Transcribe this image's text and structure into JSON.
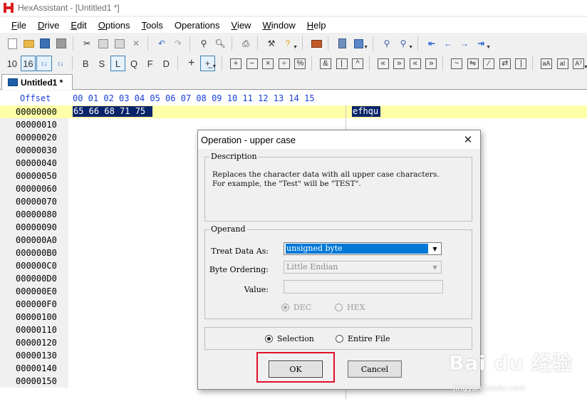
{
  "window": {
    "title": "HexAssistant - [Untitled1 *]"
  },
  "menu": [
    {
      "label": "File",
      "mnemonic": "F",
      "rest": "ile"
    },
    {
      "label": "Drive",
      "mnemonic": "D",
      "rest": "rive"
    },
    {
      "label": "Edit",
      "mnemonic": "E",
      "rest": "dit"
    },
    {
      "label": "Options",
      "mnemonic": "O",
      "rest": "ptions"
    },
    {
      "label": "Tools",
      "mnemonic": "T",
      "rest": "ools"
    },
    {
      "label": "Operations",
      "mnemonic": "",
      "rest": "Operations"
    },
    {
      "label": "View",
      "mnemonic": "V",
      "rest": "iew"
    },
    {
      "label": "Window",
      "mnemonic": "W",
      "rest": "indow"
    },
    {
      "label": "Help",
      "mnemonic": "H",
      "rest": "elp"
    }
  ],
  "toolbar2": {
    "base10": "10",
    "base16": "16",
    "modes": [
      "B",
      "S",
      "L",
      "Q",
      "F",
      "D"
    ],
    "plus": "+"
  },
  "tab": {
    "label": "Untitled1 *"
  },
  "editor": {
    "offset_header": "Offset",
    "column_header": "00 01 02 03 04 05 06 07 08 09 10 11 12 13 14 15",
    "offsets": [
      "00000000",
      "00000010",
      "00000020",
      "00000030",
      "00000040",
      "00000050",
      "00000060",
      "00000070",
      "00000080",
      "00000090",
      "000000A0",
      "000000B0",
      "000000C0",
      "000000D0",
      "000000E0",
      "000000F0",
      "00000100",
      "00000110",
      "00000120",
      "00000130",
      "00000140",
      "00000150"
    ],
    "hex_selected": "65 66 68 71 75",
    "ascii_selected": "efhqu"
  },
  "dialog": {
    "title": "Operation - upper case",
    "description_legend": "Description",
    "description_text": "Replaces the character data with all upper case characters.\nFor example, the \"Test\" will be \"TEST\".",
    "operand_legend": "Operand",
    "treat_label": "Treat Data As:",
    "treat_value": "unsigned byte",
    "ordering_label": "Byte Ordering:",
    "ordering_value": "Little Endian",
    "value_label": "Value:",
    "radio_dec": "DEC",
    "radio_hex": "HEX",
    "scope_selection": "Selection",
    "scope_entire": "Entire File",
    "ok_label": "OK",
    "cancel_label": "Cancel"
  },
  "watermark": {
    "logo": "Bai du 经验",
    "url": "jingyan.baidu.com"
  },
  "colors": {
    "selection": "#0a246a",
    "highlight_row": "#ffffa8",
    "header_text": "#1a3fd8",
    "callout_red": "#e0102a",
    "dropdown_selected": "#0078d7"
  }
}
